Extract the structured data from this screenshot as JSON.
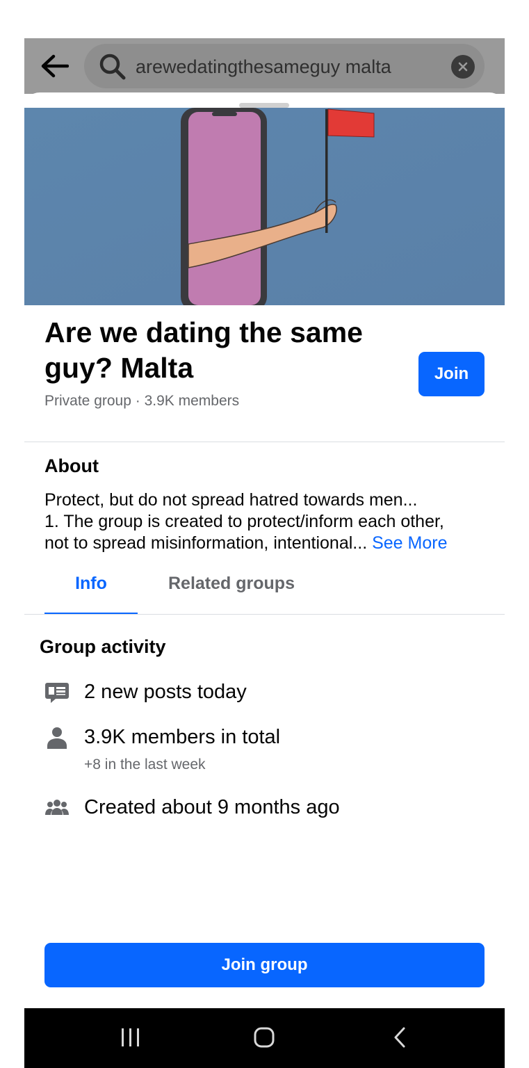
{
  "search": {
    "query": "arewedatingthesameguy malta"
  },
  "group": {
    "name": "Are we dating the same guy? Malta",
    "meta": "Private group · 3.9K members",
    "join_label": "Join"
  },
  "about": {
    "heading": "About",
    "line1": "Protect, but do not spread hatred towards men...",
    "line2": "1. The group is created to protect/inform each other,",
    "line3": "not to spread misinformation, intentional...",
    "see_more": "See More"
  },
  "tabs": [
    {
      "label": "Info",
      "active": true
    },
    {
      "label": "Related groups",
      "active": false
    }
  ],
  "activity": {
    "heading": "Group activity",
    "items": [
      {
        "icon": "posts-icon",
        "text": "2 new posts today"
      },
      {
        "icon": "person-icon",
        "text": "3.9K members in total",
        "sub": "+8 in the last week"
      },
      {
        "icon": "group-people-icon",
        "text": "Created about 9 months ago"
      }
    ]
  },
  "cta": {
    "label": "Join group"
  },
  "colors": {
    "accent": "#0866ff",
    "secondary_text": "#65676b",
    "divider": "#dadde1"
  }
}
